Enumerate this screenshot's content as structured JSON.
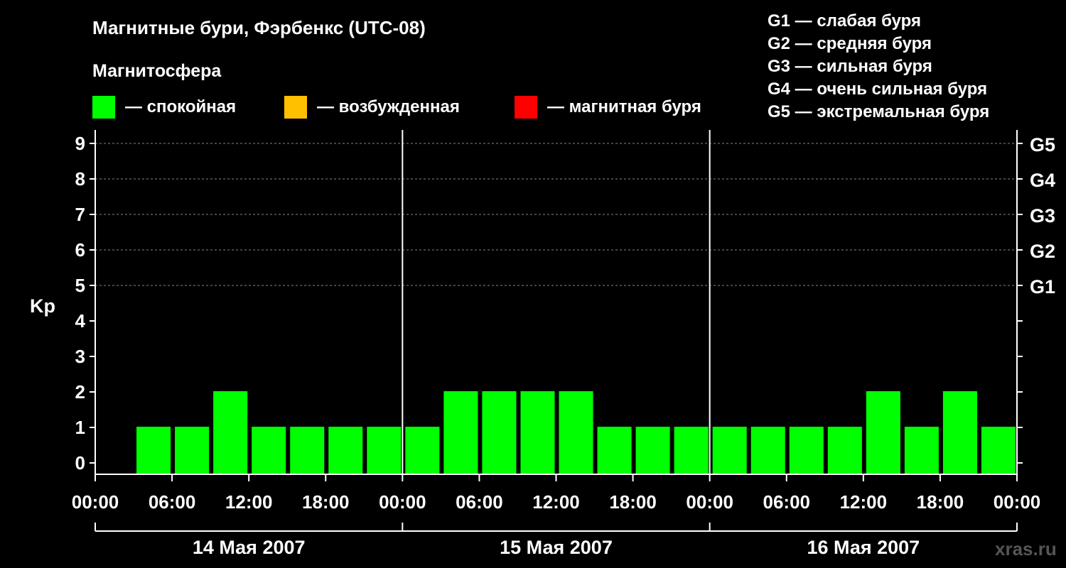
{
  "title": "Магнитные бури, Фэрбенкс (UTC-08)",
  "subtitle": "Магнитосфера",
  "legend": [
    {
      "label": "— спокойная",
      "color": "#00ff00"
    },
    {
      "label": "— возбужденная",
      "color": "#ffc000"
    },
    {
      "label": "— магнитная буря",
      "color": "#ff0000"
    }
  ],
  "gscale": [
    "G1 — слабая буря",
    "G2 — средняя буря",
    "G3 — сильная буря",
    "G4 — очень сильная буря",
    "G5 — экстремальная буря"
  ],
  "watermark": "xras.ru",
  "chart_data": {
    "type": "bar",
    "ylabel": "Kp",
    "ylim": [
      0,
      9
    ],
    "y_ticks": [
      "0",
      "1",
      "2",
      "3",
      "4",
      "5",
      "6",
      "7",
      "8",
      "9"
    ],
    "right_ticks": [
      {
        "value": 5,
        "label": "G1"
      },
      {
        "value": 6,
        "label": "G2"
      },
      {
        "value": 7,
        "label": "G3"
      },
      {
        "value": 8,
        "label": "G4"
      },
      {
        "value": 9,
        "label": "G5"
      }
    ],
    "x_ticks": [
      "00:00",
      "06:00",
      "12:00",
      "18:00",
      "00:00",
      "06:00",
      "12:00",
      "18:00",
      "00:00",
      "06:00",
      "12:00",
      "18:00",
      "00:00"
    ],
    "days": [
      "14 Мая 2007",
      "15 Мая 2007",
      "16 Мая 2007"
    ],
    "grid": "dashed horizontal at Kp 5–9",
    "bar_interval_hours": 3,
    "values": [
      null,
      1,
      1,
      2,
      1,
      1,
      1,
      1,
      1,
      2,
      2,
      2,
      2,
      1,
      1,
      1,
      1,
      1,
      1,
      1,
      2,
      1,
      2,
      1
    ],
    "colors": {
      "quiet": "#00ff00",
      "active": "#ffc000",
      "storm": "#ff0000"
    }
  }
}
